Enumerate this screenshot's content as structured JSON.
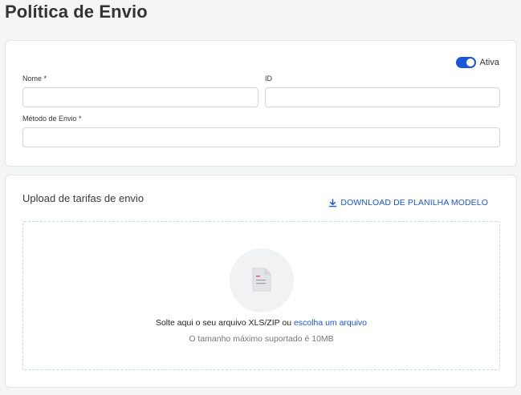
{
  "page": {
    "title": "Política de Envio"
  },
  "general": {
    "toggle_label": "Ativa",
    "toggle_on": true,
    "name_label": "Nome *",
    "name_value": "",
    "id_label": "ID",
    "id_value": "",
    "method_label": "Método de Envio *",
    "method_value": ""
  },
  "upload": {
    "title": "Upload de tarifas de envio",
    "download_label": "DOWNLOAD DE PLANILHA MODELO",
    "drop_text": "Solte aqui o seu arquivo XLS/ZIP ou",
    "choose_link": "escolha um arquivo",
    "size_text": "O tamanho máximo suportado é 10MB"
  },
  "colors": {
    "accent": "#1a56db",
    "background": "#f4f5f7",
    "card": "#ffffff",
    "dropzone_border": "#bfe0df"
  },
  "icons": {
    "download": "download-icon",
    "file": "file-icon"
  }
}
